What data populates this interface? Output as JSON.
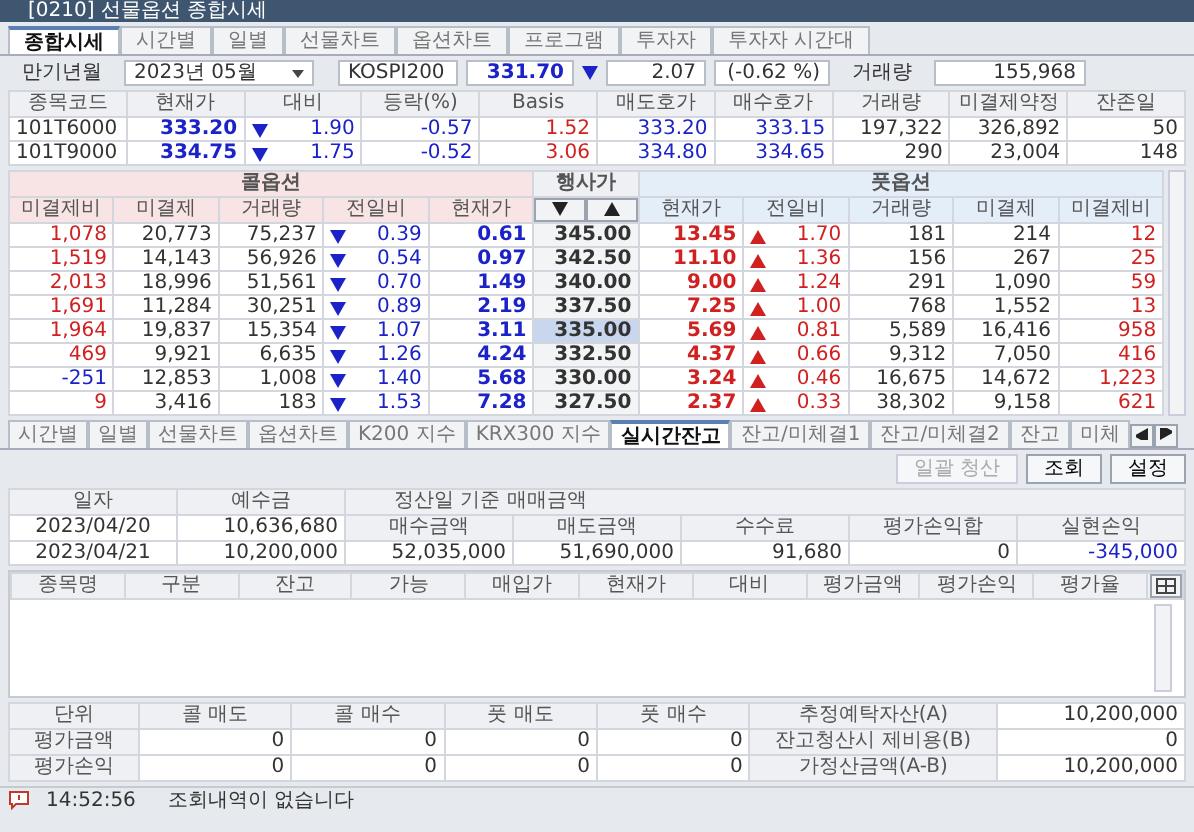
{
  "window": {
    "title": "[0210] 선물옵션 종합시세"
  },
  "top_tabs": [
    {
      "label": "종합시세",
      "selected": true
    },
    {
      "label": "시간별",
      "selected": false
    },
    {
      "label": "일별",
      "selected": false
    },
    {
      "label": "선물차트",
      "selected": false
    },
    {
      "label": "옵션차트",
      "selected": false
    },
    {
      "label": "프로그램",
      "selected": false
    },
    {
      "label": "투자자",
      "selected": false
    },
    {
      "label": "투자자 시간대",
      "selected": false
    }
  ],
  "expiry": {
    "label": "만기년월",
    "value": "2023년 05월"
  },
  "index": {
    "label": "KOSPI200",
    "value": "331.70",
    "falling": true,
    "change": "2.07",
    "change_pct": "(-0.62 %)",
    "volume_label": "거래량",
    "volume": "155,968"
  },
  "futures": {
    "columns": [
      "종목코드",
      "현재가",
      "대비",
      "등락(%)",
      "Basis",
      "매도호가",
      "매수호가",
      "거래량",
      "미결제약정",
      "잔존일"
    ],
    "rows": [
      {
        "code": "101T6000",
        "price": "333.20",
        "falling": true,
        "change": "1.90",
        "pct": "-0.57",
        "basis": "1.52",
        "ask": "333.20",
        "bid": "333.15",
        "volume": "197,322",
        "open_interest": "326,892",
        "days_left": "50"
      },
      {
        "code": "101T9000",
        "price": "334.75",
        "falling": true,
        "change": "1.75",
        "pct": "-0.52",
        "basis": "3.06",
        "ask": "334.80",
        "bid": "334.65",
        "volume": "290",
        "open_interest": "23,004",
        "days_left": "148"
      }
    ]
  },
  "options": {
    "call_title": "콜옵션",
    "put_title": "풋옵션",
    "strike_title": "행사가",
    "call_columns": [
      "미결제비",
      "미결제",
      "거래량",
      "전일비",
      "현재가"
    ],
    "put_columns": [
      "현재가",
      "전일비",
      "거래량",
      "미결제",
      "미결제비"
    ],
    "rows": [
      {
        "strike": "345.00",
        "selected": false,
        "call": {
          "oi_change": "1,078",
          "negative": false,
          "oi": "20,773",
          "volume": "75,237",
          "falling": true,
          "change": "0.39",
          "price": "0.61"
        },
        "put": {
          "price": "13.45",
          "falling": false,
          "change": "1.70",
          "volume": "181",
          "oi": "214",
          "oi_change": "12",
          "negative": false
        }
      },
      {
        "strike": "342.50",
        "selected": false,
        "call": {
          "oi_change": "1,519",
          "negative": false,
          "oi": "14,143",
          "volume": "56,926",
          "falling": true,
          "change": "0.54",
          "price": "0.97"
        },
        "put": {
          "price": "11.10",
          "falling": false,
          "change": "1.36",
          "volume": "156",
          "oi": "267",
          "oi_change": "25",
          "negative": false
        }
      },
      {
        "strike": "340.00",
        "selected": false,
        "call": {
          "oi_change": "2,013",
          "negative": false,
          "oi": "18,996",
          "volume": "51,561",
          "falling": true,
          "change": "0.70",
          "price": "1.49"
        },
        "put": {
          "price": "9.00",
          "falling": false,
          "change": "1.24",
          "volume": "291",
          "oi": "1,090",
          "oi_change": "59",
          "negative": false
        }
      },
      {
        "strike": "337.50",
        "selected": false,
        "call": {
          "oi_change": "1,691",
          "negative": false,
          "oi": "11,284",
          "volume": "30,251",
          "falling": true,
          "change": "0.89",
          "price": "2.19"
        },
        "put": {
          "price": "7.25",
          "falling": false,
          "change": "1.00",
          "volume": "768",
          "oi": "1,552",
          "oi_change": "13",
          "negative": false
        }
      },
      {
        "strike": "335.00",
        "selected": true,
        "call": {
          "oi_change": "1,964",
          "negative": false,
          "oi": "19,837",
          "volume": "15,354",
          "falling": true,
          "change": "1.07",
          "price": "3.11"
        },
        "put": {
          "price": "5.69",
          "falling": false,
          "change": "0.81",
          "volume": "5,589",
          "oi": "16,416",
          "oi_change": "958",
          "negative": false
        }
      },
      {
        "strike": "332.50",
        "selected": false,
        "call": {
          "oi_change": "469",
          "negative": false,
          "oi": "9,921",
          "volume": "6,635",
          "falling": true,
          "change": "1.26",
          "price": "4.24"
        },
        "put": {
          "price": "4.37",
          "falling": false,
          "change": "0.66",
          "volume": "9,312",
          "oi": "7,050",
          "oi_change": "416",
          "negative": false
        }
      },
      {
        "strike": "330.00",
        "selected": false,
        "call": {
          "oi_change": "-251",
          "negative": true,
          "oi": "12,853",
          "volume": "1,008",
          "falling": true,
          "change": "1.40",
          "price": "5.68"
        },
        "put": {
          "price": "3.24",
          "falling": false,
          "change": "0.46",
          "volume": "16,675",
          "oi": "14,672",
          "oi_change": "1,223",
          "negative": false
        }
      },
      {
        "strike": "327.50",
        "selected": false,
        "call": {
          "oi_change": "9",
          "negative": false,
          "oi": "3,416",
          "volume": "183",
          "falling": true,
          "change": "1.53",
          "price": "7.28"
        },
        "put": {
          "price": "2.37",
          "falling": false,
          "change": "0.33",
          "volume": "38,302",
          "oi": "9,158",
          "oi_change": "621",
          "negative": false
        }
      }
    ]
  },
  "bottom_tabs": [
    {
      "label": "시간별",
      "selected": false
    },
    {
      "label": "일별",
      "selected": false
    },
    {
      "label": "선물차트",
      "selected": false
    },
    {
      "label": "옵션차트",
      "selected": false
    },
    {
      "label": "K200 지수",
      "selected": false
    },
    {
      "label": "KRX300 지수",
      "selected": false
    },
    {
      "label": "실시간잔고",
      "selected": true
    },
    {
      "label": "잔고/미체결1",
      "selected": false
    },
    {
      "label": "잔고/미체결2",
      "selected": false
    },
    {
      "label": "잔고",
      "selected": false
    },
    {
      "label": "미체",
      "selected": false
    }
  ],
  "buttons": [
    {
      "label": "일괄 청산",
      "disabled": true
    },
    {
      "label": "조회",
      "disabled": false
    },
    {
      "label": "설정",
      "disabled": false
    }
  ],
  "deposits": {
    "columns": [
      "일자",
      "예수금"
    ],
    "rows": [
      [
        "2023/04/20",
        "10,636,680"
      ],
      [
        "2023/04/21",
        "10,200,000"
      ]
    ]
  },
  "settlement": {
    "title": "정산일 기준 매매금액",
    "columns": [
      "매수금액",
      "매도금액",
      "수수료",
      "평가손익합",
      "실현손익"
    ],
    "values": [
      {
        "text": "52,035,000",
        "negative": false
      },
      {
        "text": "51,690,000",
        "negative": false
      },
      {
        "text": "91,680",
        "negative": false
      },
      {
        "text": "0",
        "negative": false
      },
      {
        "text": "-345,000",
        "negative": true
      }
    ]
  },
  "holdings": {
    "columns": [
      "종목명",
      "구분",
      "잔고",
      "가능",
      "매입가",
      "현재가",
      "대비",
      "평가금액",
      "평가손익",
      "평가율"
    ]
  },
  "summary": {
    "columns": [
      "단위",
      "콜 매도",
      "콜 매수",
      "풋 매도",
      "풋 매수"
    ],
    "rows": [
      {
        "label": "평가금액",
        "values": [
          "0",
          "0",
          "0",
          "0"
        ]
      },
      {
        "label": "평가손익",
        "values": [
          "0",
          "0",
          "0",
          "0"
        ]
      }
    ],
    "assets": [
      {
        "label": "추정예탁자산(A)",
        "value": "10,200,000"
      },
      {
        "label": "잔고청산시 제비용(B)",
        "value": "0"
      },
      {
        "label": "가정산금액(A-B)",
        "value": "10,200,000"
      }
    ]
  },
  "status_bar": {
    "time": "14:52:56",
    "message": "조회내역이 없습니다"
  }
}
